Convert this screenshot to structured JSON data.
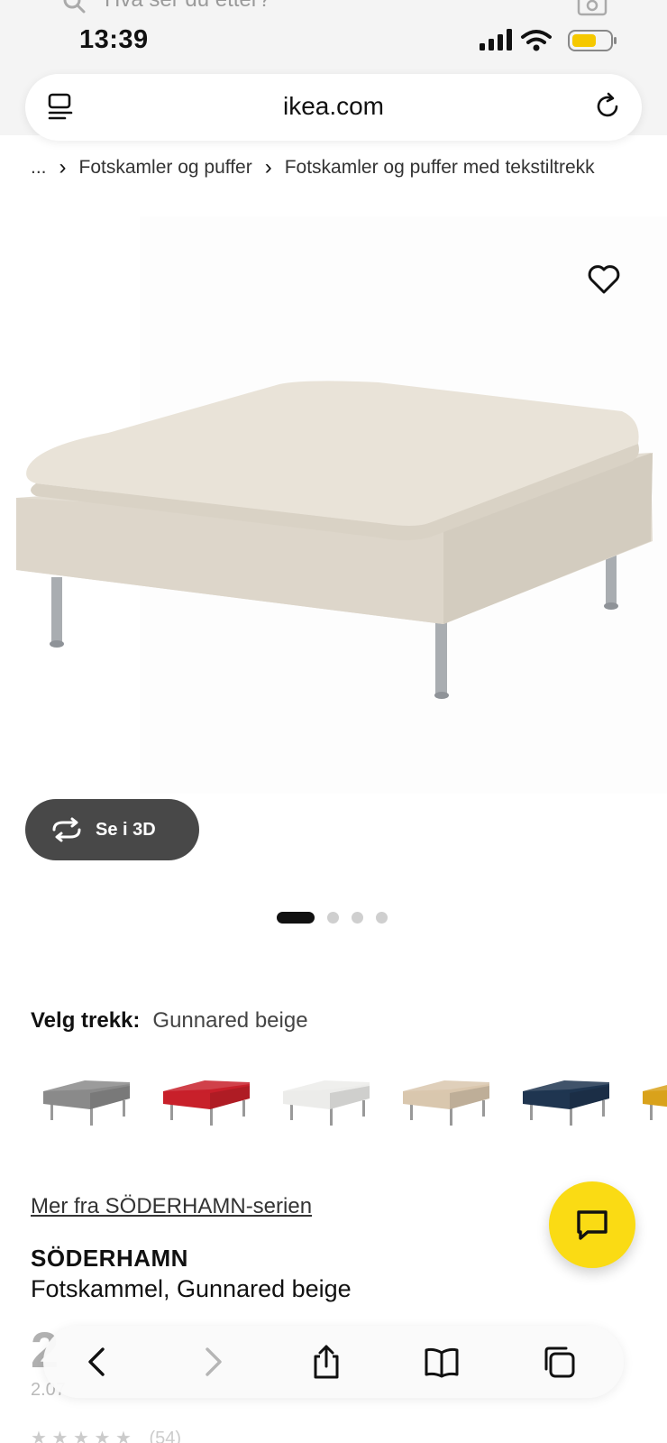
{
  "status": {
    "time": "13:39"
  },
  "search": {
    "placeholder": "Hva ser du etter?"
  },
  "address": {
    "url": "ikea.com"
  },
  "breadcrumb": {
    "ellipsis": "...",
    "items": [
      "Fotskamler og puffer",
      "Fotskamler og puffer med tekstiltrekk"
    ]
  },
  "gallery": {
    "view3d_label": "Se i 3D",
    "dots": 4,
    "active_dot": 0
  },
  "cover": {
    "label": "Velg trekk:",
    "value": "Gunnared beige",
    "swatches": [
      {
        "name": "grey",
        "color": "#8a8a8a"
      },
      {
        "name": "red",
        "color": "#c8202a"
      },
      {
        "name": "white",
        "color": "#ececea"
      },
      {
        "name": "beige",
        "color": "#d9c7ae"
      },
      {
        "name": "dark-blue",
        "color": "#1f3550"
      },
      {
        "name": "yellow",
        "color": "#d9a21b"
      }
    ]
  },
  "product": {
    "series_link": "Mer fra SÖDERHAMN-serien",
    "name": "SÖDERHAMN",
    "description": "Fotskammel, Gunnared beige",
    "price_partial": "2",
    "price_sub_partial": "2.07",
    "rating_count": "(54)"
  },
  "colors": {
    "accent": "#fadb14",
    "button_dark": "#484848"
  }
}
